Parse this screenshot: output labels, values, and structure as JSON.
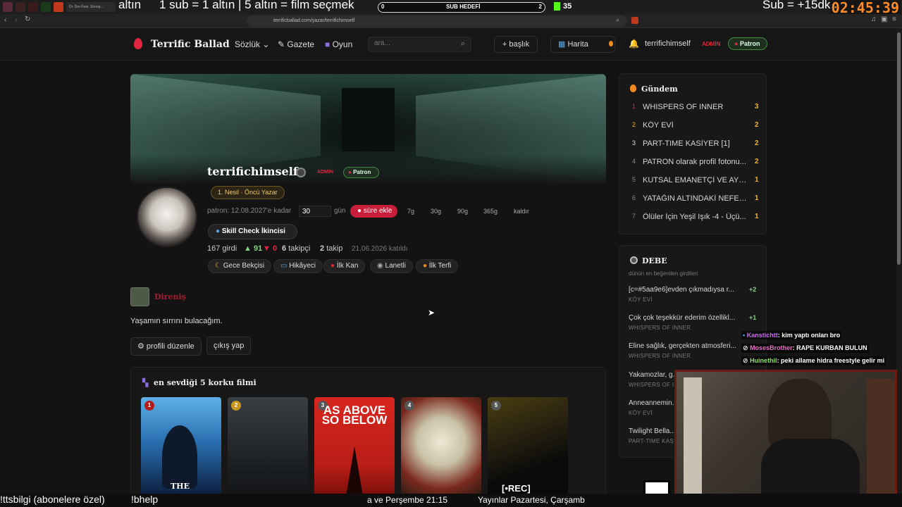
{
  "overlay": {
    "altin_text": "altın",
    "sub_text": "1 sub = 1 altın | 5 altın = film seçmek",
    "subgoal_left": "0",
    "subgoal_label": "SUB HEDEFİ",
    "subgoal_right": "2",
    "kick_count": "35",
    "sub_reward": "Sub = +15dk",
    "timer": "02:45:39",
    "tab_label": "Dr. Dre Feat. Snoop..."
  },
  "browser": {
    "url": "terrificballad.com/yazar/terrifichimself"
  },
  "header": {
    "logo": "Terrific Ballad",
    "nav": [
      "Sözlük",
      "Gazete",
      "Oyun"
    ],
    "search_placeholder": "ara...",
    "new_topic": "+ başlık",
    "map": "Harita",
    "username": "terrifichimself",
    "admin_badge": "ADMİN",
    "patron_badge": "Patron"
  },
  "profile": {
    "name": "terrifichimself",
    "admin_badge": "ADMİN",
    "patron_badge": "Patron",
    "rank_badge": "1. Nesil · Öncü Yazar",
    "patron_until": "patron: 12.08.2027'e kadar",
    "days_value": "30",
    "days_unit": "gün",
    "add_time": "süre ekle",
    "durations": [
      "7g",
      "30g",
      "90g",
      "365g",
      "kaldır"
    ],
    "skill_badge": "Skill Check İkincisi",
    "entries": "167 girdi",
    "upvotes": "▲ 91",
    "downvotes": "▼ 0",
    "followers_num": "6",
    "followers_label": "takipçi",
    "following_num": "2",
    "following_label": "takip",
    "joined": "21.06.2026 katıldı",
    "achievements": [
      "Gece Bekçisi",
      "Hikâyeci",
      "İlk Kan",
      "Lanetli",
      "İlk Terfi"
    ],
    "faction": "Direniş",
    "bio": "Yaşamın sırrını bulacağım.",
    "edit_profile": "⚙ profili düzenle",
    "logout": "çıkış yap"
  },
  "films": {
    "title": "en sevdiği 5 korku filmi",
    "items": [
      {
        "rank": "1",
        "color": "#b31b1b",
        "title": "THE"
      },
      {
        "rank": "2",
        "color": "#c8961e",
        "title": ""
      },
      {
        "rank": "3",
        "color": "#555555",
        "title": "AS ABOVE SO BELOW"
      },
      {
        "rank": "4",
        "color": "#555555",
        "title": ""
      },
      {
        "rank": "5",
        "color": "#555555",
        "title": "[•REC]"
      }
    ]
  },
  "gundem": {
    "title": "Gündem",
    "items": [
      {
        "num": "1",
        "title": "WHISPERS OF INNER",
        "count": "3"
      },
      {
        "num": "2",
        "title": "KÖY EVİ",
        "count": "2"
      },
      {
        "num": "3",
        "title": "PART-TIME KASİYER [1]",
        "count": "2"
      },
      {
        "num": "4",
        "title": "PATRON olarak profil fotonu...",
        "count": "2"
      },
      {
        "num": "5",
        "title": "KUTSAL EMANETÇİ VE AYN...",
        "count": "1"
      },
      {
        "num": "6",
        "title": "YATAĞIN ALTINDAKİ NEFES ...",
        "count": "1"
      },
      {
        "num": "7",
        "title": "Ölüler İçin Yeşil Işık -4 - Üçü...",
        "count": "1"
      }
    ]
  },
  "debe": {
    "title": "DEBE",
    "subtitle": "dünün en beğenilen girdileri",
    "items": [
      {
        "title": "[c=#5aa9e6]evden çıkmadıysa r...",
        "topic": "KÖY EVİ",
        "score": "+2"
      },
      {
        "title": "Çok çok teşekkür ederim özellikl...",
        "topic": "WHISPERS OF INNER",
        "score": "+1"
      },
      {
        "title": "Eline sağlık, gerçekten atmosferi...",
        "topic": "WHISPERS OF INNER",
        "score": ""
      },
      {
        "title": "Yakamozlar, g...",
        "topic": "WHISPERS OF IN...",
        "score": ""
      },
      {
        "title": "Anneannemin...",
        "topic": "KÖY EVİ",
        "score": ""
      },
      {
        "title": "Twilight Bella...",
        "topic": "PART-TIME KAS...",
        "score": ""
      }
    ]
  },
  "chat": [
    {
      "user": "Kanstichtt",
      "color": "#c96cf0",
      "msg": ": kim yaptı onları bro"
    },
    {
      "user": "MosesBrother",
      "color": "#e870c8",
      "msg": ": RAPE KURBAN BULUN"
    },
    {
      "user": "Huinethil",
      "color": "#8ee26b",
      "msg": ": peki allame hidra freestyle gelir mi"
    }
  ],
  "bottom": {
    "cmd1": "!ttsbilgi (abonelere özel)",
    "cmd2": "!bhelp",
    "ticker1": "a ve Perşembe 21:15",
    "ticker2": "Yayınlar Pazartesi, Çarşamb"
  },
  "colors": {
    "accent_red": "#e0263f",
    "admin": "#e0263f",
    "patron_green": "#3f8a3f",
    "trend_count": "#f0b429",
    "score_green": "#7fd77f"
  }
}
